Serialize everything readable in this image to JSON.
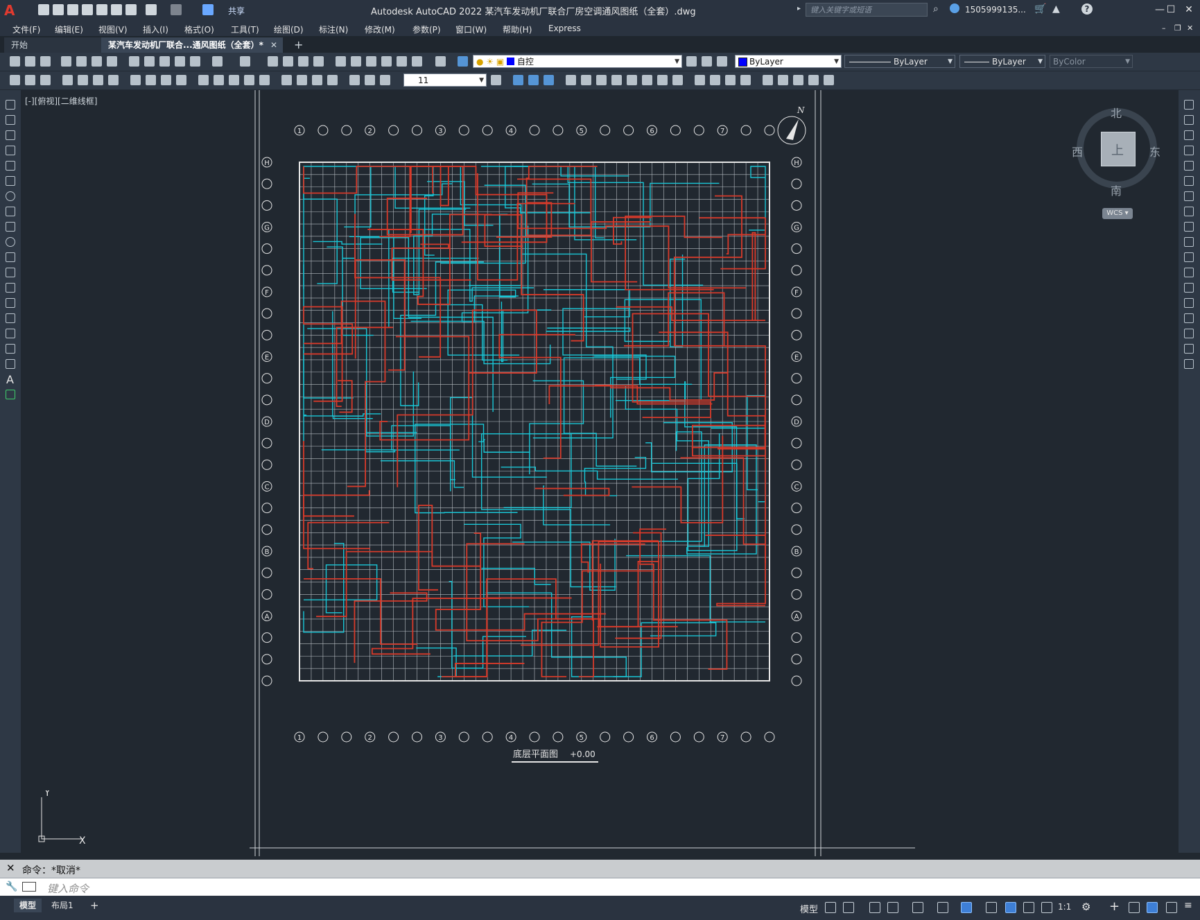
{
  "app": {
    "logo": "A",
    "window_title": "Autodesk AutoCAD 2022    某汽车发动机厂联合厂房空调通风图纸（全套）.dwg",
    "share_label": "共享",
    "search_placeholder": "键入关键字或短语",
    "user_name": "1505999135...",
    "window_controls": [
      "minimize-icon",
      "maximize-icon",
      "close-icon"
    ]
  },
  "menu": [
    "文件(F)",
    "编辑(E)",
    "视图(V)",
    "插入(I)",
    "格式(O)",
    "工具(T)",
    "绘图(D)",
    "标注(N)",
    "修改(M)",
    "参数(P)",
    "窗口(W)",
    "帮助(H)",
    "Express"
  ],
  "tabs": {
    "start": "开始",
    "drawing": "某汽车发动机厂联合...通风图纸（全套）*",
    "add": "+"
  },
  "properties": {
    "layer": "自控",
    "color": "ByLayer",
    "color_swatch": "#0000ff",
    "linetype": "ByLayer",
    "lineweight": "ByLayer",
    "plotstyle": "ByColor",
    "dimscale": "11"
  },
  "viewport": {
    "label": "[-][俯视][二维线框]",
    "compass": {
      "north": "北",
      "south": "南",
      "east": "东",
      "west": "西",
      "top_face": "上"
    },
    "wcs": "WCS",
    "north_arrow": "N",
    "ucs": {
      "x": "X",
      "y": "Y"
    }
  },
  "drawing": {
    "plan_title": "底层平面图",
    "elevation": "+0.00",
    "column_axis_labels": [
      "1",
      "2",
      "3",
      "4",
      "5",
      "6",
      "7"
    ],
    "row_axis_labels": [
      "H",
      "G",
      "F",
      "E",
      "D",
      "C",
      "B",
      "A"
    ]
  },
  "command": {
    "history": "命令：*取消*",
    "placeholder": "键入命令"
  },
  "status": {
    "layouts": [
      "模型",
      "布局1"
    ],
    "model_label": "模型",
    "scale": "1:1"
  },
  "colors": {
    "background": "#212830",
    "duct_red": "#d83a2a",
    "duct_cyan": "#19c8d8",
    "grid": "#c8ccd0",
    "accent_blue": "#3e7fd6"
  }
}
